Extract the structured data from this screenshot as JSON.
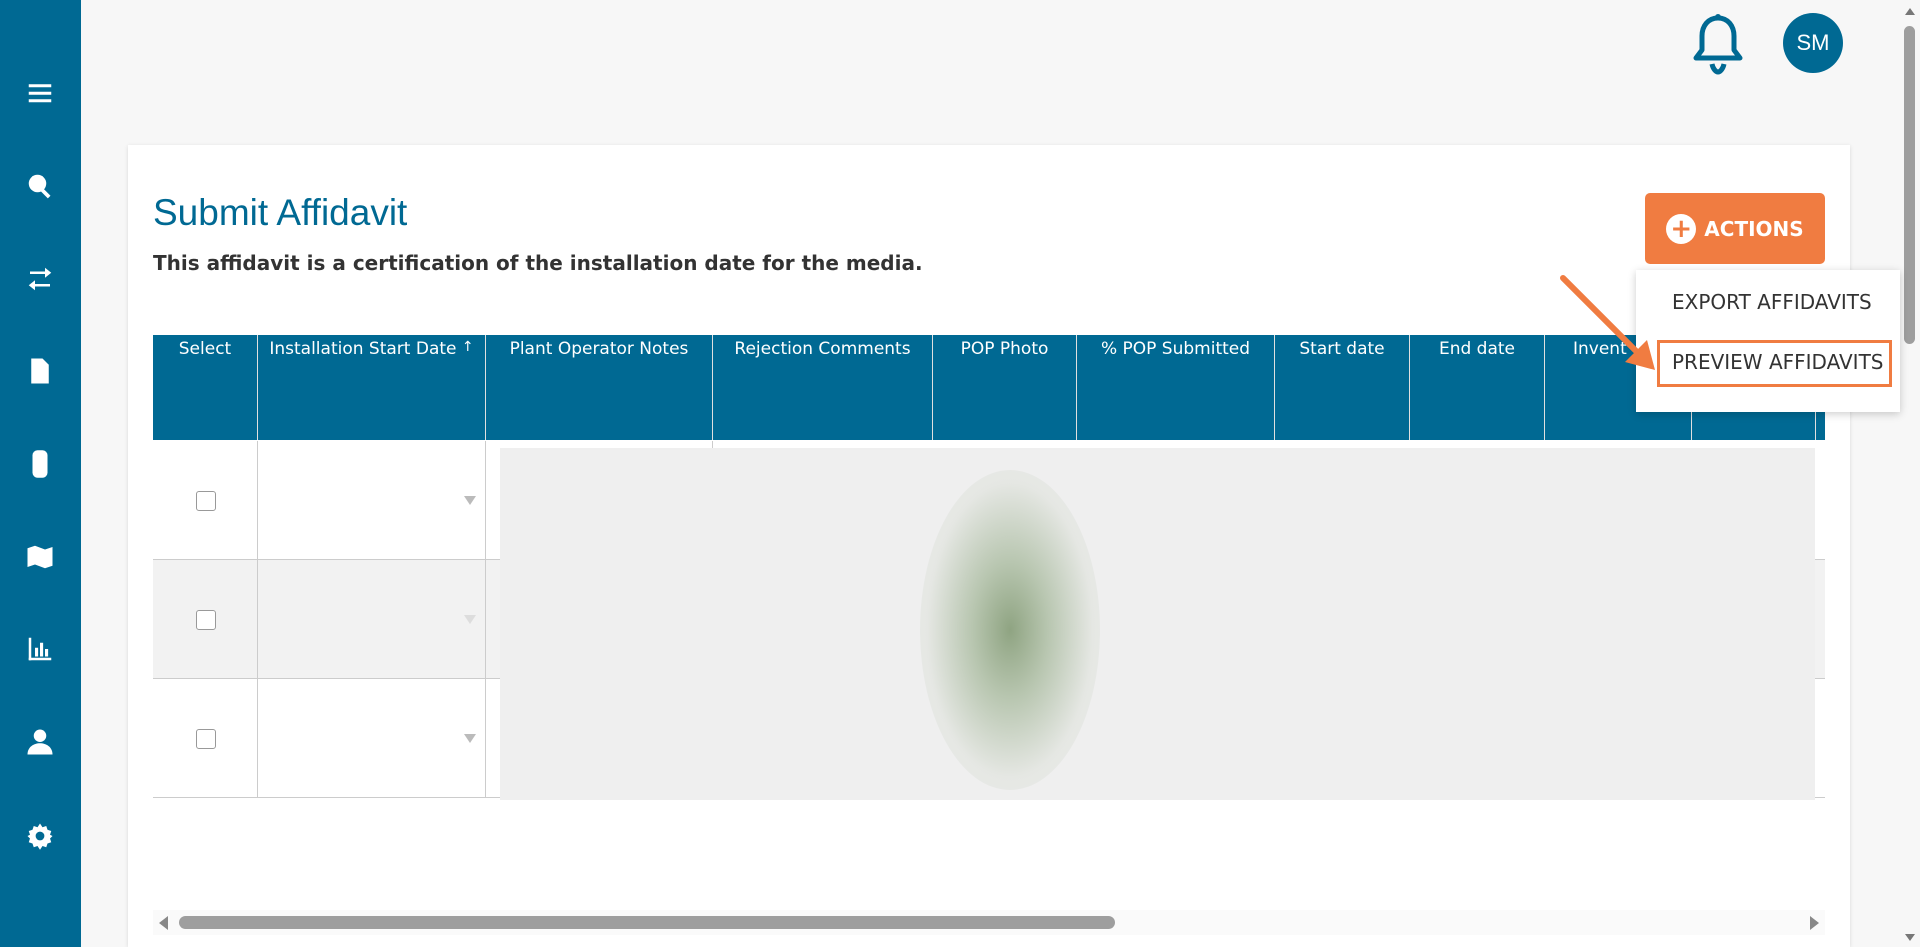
{
  "page": {
    "title": "Submit Affidavit",
    "subtitle": "This affidavit is a certification of the installation date for the media."
  },
  "header": {
    "avatar_initials": "SM"
  },
  "actions": {
    "label": "ACTIONS",
    "menu": [
      "EXPORT AFFIDAVITS",
      "PREVIEW AFFIDAVITS"
    ]
  },
  "table": {
    "columns": [
      "Select",
      "Installation Start Date",
      "Plant Operator Notes",
      "Rejection Comments",
      "POP Photo",
      "% POP Submitted",
      "Start date",
      "End date",
      "Invent"
    ],
    "sort_indicator": "↑"
  },
  "sidebar": {
    "icons": [
      "menu-icon",
      "search-analytics-icon",
      "transfer-icon",
      "invoice-icon",
      "traffic-light-icon",
      "map-icon",
      "bar-chart-icon",
      "user-icon",
      "settings-icon"
    ]
  },
  "colors": {
    "primary": "#006993",
    "accent": "#f07c41"
  }
}
